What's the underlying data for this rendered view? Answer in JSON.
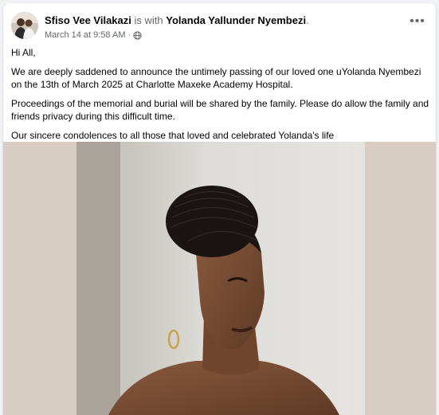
{
  "post": {
    "author": "Sfiso Vee Vilakazi",
    "with_text": "is with",
    "tagged": "Yolanda Yallunder Nyembezi",
    "period": ".",
    "timestamp": "March 14 at 9:58 AM",
    "separator": "·",
    "privacy_icon": "globe-icon",
    "more_label": "•••",
    "paragraphs": [
      "Hi All,",
      "We are deeply saddened to announce the untimely passing of our loved one uYolanda Nyembezi on the 13th of March 2025 at Charlotte Maxeke Academy Hospital.",
      "Proceedings of the memorial and burial will be shared by the family. Please do allow the family and friends privacy during this difficult time.",
      "Our sincere condolences to all those that loved and celebrated Yolanda's life"
    ]
  },
  "colors": {
    "background": "#f0f2f5",
    "card": "#ffffff",
    "text_primary": "#050505",
    "text_secondary": "#65676b",
    "photo_backdrop": "#d8cdc3"
  }
}
